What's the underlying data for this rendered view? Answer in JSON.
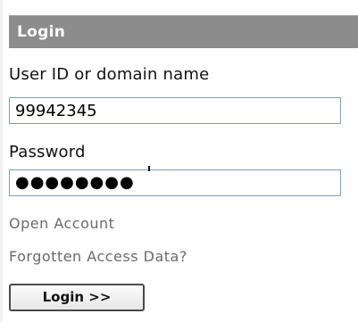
{
  "header": {
    "title": "Login"
  },
  "user_id": {
    "label": "User ID or domain name",
    "value": "99942345"
  },
  "password": {
    "label": "Password",
    "masked_value": "●●●●●●●●"
  },
  "links": {
    "open_account": "Open Account",
    "forgotten_access": "Forgotten Access Data?"
  },
  "login_button": {
    "label": "Login >>"
  },
  "colors": {
    "header_bg": "#8c8c8c",
    "header_text": "#ffffff",
    "field_border": "#7f9db9",
    "link_text": "#6a6a6a"
  }
}
